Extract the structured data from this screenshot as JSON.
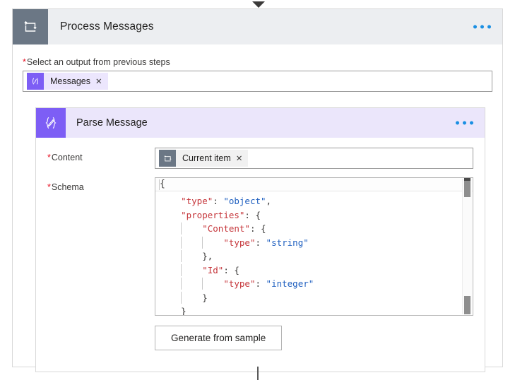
{
  "connector": {
    "top_arrow_icon": "chevron-down-icon",
    "bottom_line_icon": "flow-connector-line"
  },
  "outer_card": {
    "icon": "loop-foreach-icon",
    "title": "Process Messages",
    "menu_icon": "more-options-icon",
    "field": {
      "label": "Select an output from previous steps",
      "required_marker": "*",
      "token": {
        "icon": "expression-code-icon",
        "label": "Messages",
        "remove_icon": "close-icon",
        "remove_glyph": "✕"
      }
    }
  },
  "inner_card": {
    "icon": "parse-json-pen-icon",
    "title": "Parse Message",
    "menu_icon": "more-options-icon",
    "fields": [
      {
        "label": "Content",
        "required_marker": "*",
        "token": {
          "icon": "loop-current-item-icon",
          "label": "Current item",
          "remove_icon": "close-icon",
          "remove_glyph": "✕"
        }
      },
      {
        "label": "Schema",
        "required_marker": "*"
      }
    ],
    "schema_editor": {
      "first_line": "{",
      "lines": [
        {
          "indent": 4,
          "guides": 0,
          "parts": [
            {
              "t": "\"type\"",
              "c": "k"
            },
            {
              "t": ": ",
              "c": "p"
            },
            {
              "t": "\"object\"",
              "c": "v"
            },
            {
              "t": ",",
              "c": "p"
            }
          ]
        },
        {
          "indent": 4,
          "guides": 0,
          "parts": [
            {
              "t": "\"properties\"",
              "c": "k"
            },
            {
              "t": ": {",
              "c": "p"
            }
          ]
        },
        {
          "indent": 8,
          "guides": 1,
          "parts": [
            {
              "t": "\"Content\"",
              "c": "k"
            },
            {
              "t": ": {",
              "c": "p"
            }
          ]
        },
        {
          "indent": 12,
          "guides": 2,
          "parts": [
            {
              "t": "\"type\"",
              "c": "k"
            },
            {
              "t": ": ",
              "c": "p"
            },
            {
              "t": "\"string\"",
              "c": "v"
            }
          ]
        },
        {
          "indent": 8,
          "guides": 1,
          "parts": [
            {
              "t": "},",
              "c": "p"
            }
          ]
        },
        {
          "indent": 8,
          "guides": 1,
          "parts": [
            {
              "t": "\"Id\"",
              "c": "k"
            },
            {
              "t": ": {",
              "c": "p"
            }
          ]
        },
        {
          "indent": 12,
          "guides": 2,
          "parts": [
            {
              "t": "\"type\"",
              "c": "k"
            },
            {
              "t": ": ",
              "c": "p"
            },
            {
              "t": "\"integer\"",
              "c": "v"
            }
          ]
        },
        {
          "indent": 8,
          "guides": 1,
          "parts": [
            {
              "t": "}",
              "c": "p"
            }
          ]
        },
        {
          "indent": 4,
          "guides": 0,
          "parts": [
            {
              "t": "}",
              "c": "p"
            }
          ]
        }
      ],
      "scrollbar_icon": "vertical-scrollbar"
    },
    "generate_button": "Generate from sample"
  },
  "colors": {
    "accent_purple": "#7d5ef5",
    "inner_header_bg": "#ebe6fb",
    "outer_header_bg": "#eceef1",
    "outer_icon_bg": "#6b7785",
    "required_red": "#e81123",
    "menu_blue": "#1a8fe3",
    "json_key_red": "#c5353a",
    "json_value_blue": "#2060c0"
  }
}
